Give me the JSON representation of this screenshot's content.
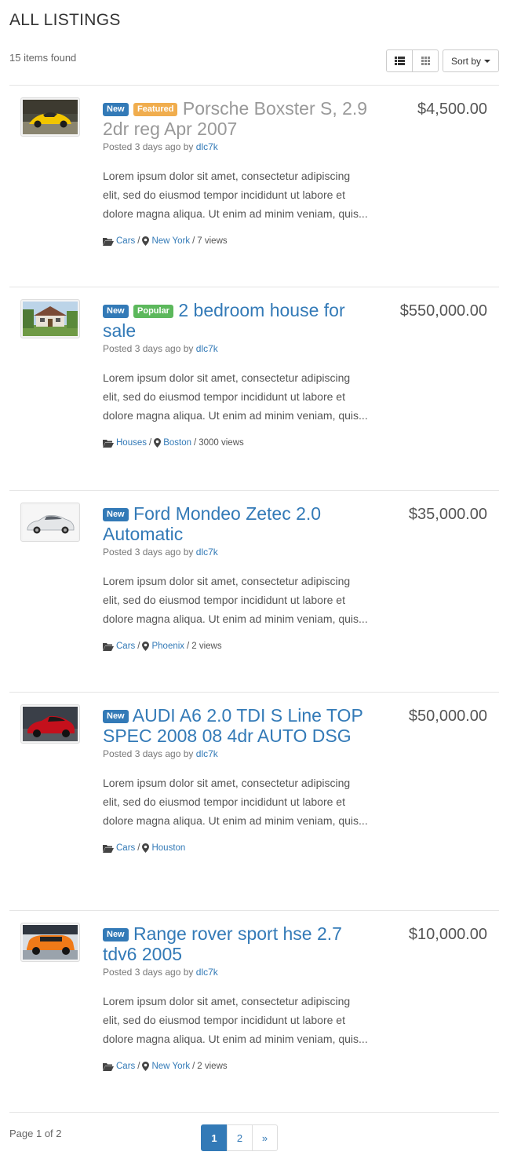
{
  "header": {
    "title": "ALL LISTINGS",
    "items_found": "15 items found",
    "sort_label": "Sort by"
  },
  "listings": [
    {
      "badges": [
        "New",
        "Featured"
      ],
      "title": "Porsche Boxster S, 2.9 2dr reg Apr 2007",
      "posted_prefix": "Posted 3 days ago by",
      "author": "dlc7k",
      "description": "Lorem ipsum dolor sit amet, consectetur adipiscing elit, sed do eiusmod tempor incididunt ut labore et dolore magna aliqua. Ut enim ad minim veniam, quis...",
      "category": "Cars",
      "location": "New York",
      "views": "7 views",
      "price": "$4,500.00"
    },
    {
      "badges": [
        "New",
        "Popular"
      ],
      "title": "2 bedroom house for sale",
      "posted_prefix": "Posted 3 days ago by",
      "author": "dlc7k",
      "description": "Lorem ipsum dolor sit amet, consectetur adipiscing elit, sed do eiusmod tempor incididunt ut labore et dolore magna aliqua. Ut enim ad minim veniam, quis...",
      "category": "Houses",
      "location": "Boston",
      "views": "3000 views",
      "price": "$550,000.00"
    },
    {
      "badges": [
        "New"
      ],
      "title": "Ford Mondeo Zetec 2.0 Automatic",
      "posted_prefix": "Posted 3 days ago by",
      "author": "dlc7k",
      "description": "Lorem ipsum dolor sit amet, consectetur adipiscing elit, sed do eiusmod tempor incididunt ut labore et dolore magna aliqua. Ut enim ad minim veniam, quis...",
      "category": "Cars",
      "location": "Phoenix",
      "views": "2 views",
      "price": "$35,000.00"
    },
    {
      "badges": [
        "New"
      ],
      "title": "AUDI A6 2.0 TDI S Line TOP SPEC 2008 08 4dr AUTO DSG",
      "posted_prefix": "Posted 3 days ago by",
      "author": "dlc7k",
      "description": "Lorem ipsum dolor sit amet, consectetur adipiscing elit, sed do eiusmod tempor incididunt ut labore et dolore magna aliqua. Ut enim ad minim veniam, quis...",
      "category": "Cars",
      "location": "Houston",
      "views": "",
      "price": "$50,000.00"
    },
    {
      "badges": [
        "New"
      ],
      "title": "Range rover sport hse 2.7 tdv6 2005",
      "posted_prefix": "Posted 3 days ago by",
      "author": "dlc7k",
      "description": "Lorem ipsum dolor sit amet, consectetur adipiscing elit, sed do eiusmod tempor incididunt ut labore et dolore magna aliqua. Ut enim ad minim veniam, quis...",
      "category": "Cars",
      "location": "New York",
      "views": "2 views",
      "price": "$10,000.00"
    }
  ],
  "footer": {
    "page_label": "Page 1 of 2",
    "pages": [
      "1",
      "2",
      "»"
    ]
  },
  "colors": {
    "link": "#337ab7",
    "badge_new": "#337ab7",
    "badge_featured": "#f0ad4e",
    "badge_popular": "#5cb85c"
  },
  "icons": {
    "list_view": "list-view-icon",
    "grid_view": "grid-view-icon",
    "category": "folder-open-icon",
    "location": "map-marker-icon"
  }
}
